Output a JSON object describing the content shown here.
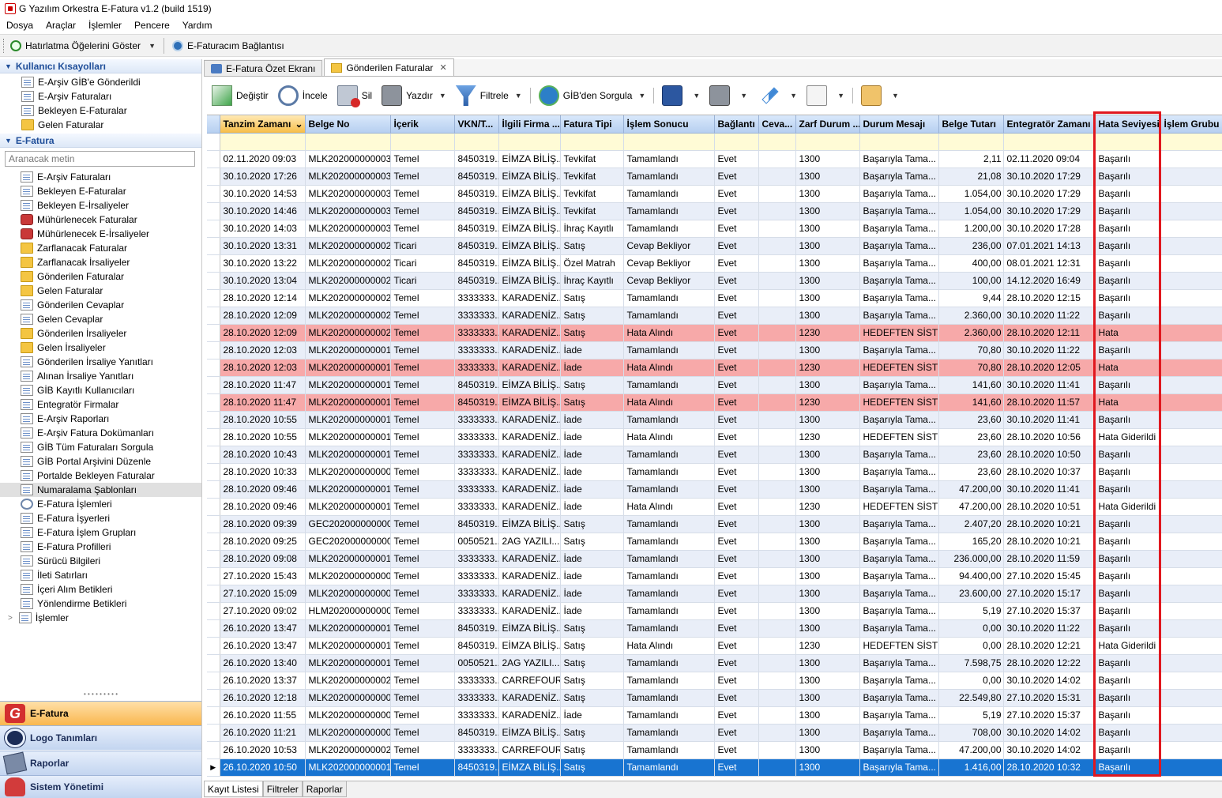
{
  "window": {
    "title": "G Yazılım Orkestra E-Fatura v1.2 (build 1519)"
  },
  "menu": [
    "Dosya",
    "Araçlar",
    "İşlemler",
    "Pencere",
    "Yardım"
  ],
  "toolbar1": {
    "reminders_label": "Hatırlatma Öğelerini Göster",
    "connect_label": "E-Faturacım Bağlantısı"
  },
  "sidebar": {
    "shortcuts_title": "Kullanıcı Kısayolları",
    "shortcuts": [
      "E-Arşiv GİB'e Gönderildi",
      "E-Arşiv Faturaları",
      "Bekleyen E-Faturalar",
      "Gelen Faturalar"
    ],
    "efatura_title": "E-Fatura",
    "search_placeholder": "Aranacak metin",
    "items": [
      "E-Arşiv Faturaları",
      "Bekleyen E-Faturalar",
      "Bekleyen E-İrsaliyeler",
      "Mühürlenecek Faturalar",
      "Mühürlenecek E-İrsaliyeler",
      "Zarflanacak Faturalar",
      "Zarflanacak İrsaliyeler",
      "Gönderilen Faturalar",
      "Gelen Faturalar",
      "Gönderilen Cevaplar",
      "Gelen Cevaplar",
      "Gönderilen İrsaliyeler",
      "Gelen İrsaliyeler",
      "Gönderilen İrsaliye Yanıtları",
      "Alınan İrsaliye Yanıtları",
      "GİB Kayıtlı Kullanıcıları",
      "Entegratör Firmalar",
      "E-Arşiv Raporları",
      "E-Arşiv Fatura Dokümanları",
      "GİB Tüm Faturaları Sorgula",
      "GİB Portal Arşivini Düzenle",
      "Portalde Bekleyen Faturalar",
      "Numaralama Şablonları",
      "E-Fatura İşlemleri",
      "E-Fatura İşyerleri",
      "E-Fatura İşlem Grupları",
      "E-Fatura Profilleri",
      "Sürücü Bilgileri",
      "İleti Satırları",
      "İçeri Alım Betikleri",
      "Yönlendirme Betikleri"
    ],
    "tree_last": "İşlemler",
    "nav": [
      "E-Fatura",
      "Logo Tanımları",
      "Raporlar",
      "Sistem Yönetimi"
    ]
  },
  "tabs": [
    {
      "label": "E-Fatura Özet Ekranı"
    },
    {
      "label": "Gönderilen Faturalar"
    }
  ],
  "toolbar2": {
    "change": "Değiştir",
    "view": "İncele",
    "delete": "Sil",
    "print": "Yazdır",
    "filter": "Filtrele",
    "gib_query": "GİB'den Sorgula"
  },
  "grid": {
    "columns": [
      "Tanzim Zamanı",
      "Belge No",
      "İçerik",
      "VKN/T...",
      "İlgili Firma ...",
      "Fatura Tipi",
      "İşlem Sonucu",
      "Bağlantı",
      "Ceva...",
      "Zarf Durum ...",
      "Durum Mesajı",
      "Belge Tutarı",
      "Entegratör Zamanı",
      "Hata Seviyesi",
      "İşlem Grubu"
    ],
    "rows": [
      [
        "02.11.2020 09:03",
        "MLK2020000000035",
        "Temel",
        "8450319...",
        "EİMZA BİLİŞ...",
        "Tevkifat",
        "Tamamlandı",
        "Evet",
        "",
        "1300",
        "Başarıyla Tama...",
        "2,11",
        "02.11.2020 09:04",
        "Başarılı",
        ""
      ],
      [
        "30.10.2020 17:26",
        "MLK2020000000034",
        "Temel",
        "8450319...",
        "EİMZA BİLİŞ...",
        "Tevkifat",
        "Tamamlandı",
        "Evet",
        "",
        "1300",
        "Başarıyla Tama...",
        "21,08",
        "30.10.2020 17:29",
        "Başarılı",
        ""
      ],
      [
        "30.10.2020 14:53",
        "MLK2020000000032",
        "Temel",
        "8450319...",
        "EİMZA BİLİŞ...",
        "Tevkifat",
        "Tamamlandı",
        "Evet",
        "",
        "1300",
        "Başarıyla Tama...",
        "1.054,00",
        "30.10.2020 17:29",
        "Başarılı",
        ""
      ],
      [
        "30.10.2020 14:46",
        "MLK2020000000031",
        "Temel",
        "8450319...",
        "EİMZA BİLİŞ...",
        "Tevkifat",
        "Tamamlandı",
        "Evet",
        "",
        "1300",
        "Başarıyla Tama...",
        "1.054,00",
        "30.10.2020 17:29",
        "Başarılı",
        ""
      ],
      [
        "30.10.2020 14:03",
        "MLK2020000000030",
        "Temel",
        "8450319...",
        "EİMZA BİLİŞ...",
        "İhraç Kayıtlı",
        "Tamamlandı",
        "Evet",
        "",
        "1300",
        "Başarıyla Tama...",
        "1.200,00",
        "30.10.2020 17:28",
        "Başarılı",
        ""
      ],
      [
        "30.10.2020 13:31",
        "MLK2020000000025",
        "Ticari",
        "8450319...",
        "EİMZA BİLİŞ...",
        "Satış",
        "Cevap Bekliyor",
        "Evet",
        "",
        "1300",
        "Başarıyla Tama...",
        "236,00",
        "07.01.2021 14:13",
        "Başarılı",
        ""
      ],
      [
        "30.10.2020 13:22",
        "MLK2020000000024",
        "Ticari",
        "8450319...",
        "EİMZA BİLİŞ...",
        "Özel Matrah",
        "Cevap Bekliyor",
        "Evet",
        "",
        "1300",
        "Başarıyla Tama...",
        "400,00",
        "08.01.2021 12:31",
        "Başarılı",
        ""
      ],
      [
        "30.10.2020 13:04",
        "MLK2020000000022",
        "Ticari",
        "8450319...",
        "EİMZA BİLİŞ...",
        "İhraç Kayıtlı",
        "Cevap Bekliyor",
        "Evet",
        "",
        "1300",
        "Başarıyla Tama...",
        "100,00",
        "14.12.2020 16:49",
        "Başarılı",
        ""
      ],
      [
        "28.10.2020 12:14",
        "MLK2020000000021",
        "Temel",
        "3333333...",
        "KARADENİZ...",
        "Satış",
        "Tamamlandı",
        "Evet",
        "",
        "1300",
        "Başarıyla Tama...",
        "9,44",
        "28.10.2020 12:15",
        "Başarılı",
        ""
      ],
      [
        "28.10.2020 12:09",
        "MLK2020000000020",
        "Temel",
        "3333333...",
        "KARADENİZ...",
        "Satış",
        "Tamamlandı",
        "Evet",
        "",
        "1300",
        "Başarıyla Tama...",
        "2.360,00",
        "30.10.2020 11:22",
        "Başarılı",
        ""
      ],
      [
        "28.10.2020 12:09",
        "MLK2020000000020",
        "Temel",
        "3333333...",
        "KARADENİZ...",
        "Satış",
        "Hata Alındı",
        "Evet",
        "",
        "1230",
        "HEDEFTEN SİSTE...",
        "2.360,00",
        "28.10.2020 12:11",
        "Hata",
        ""
      ],
      [
        "28.10.2020 12:03",
        "MLK2020000000019",
        "Temel",
        "3333333...",
        "KARADENİZ...",
        "İade",
        "Tamamlandı",
        "Evet",
        "",
        "1300",
        "Başarıyla Tama...",
        "70,80",
        "30.10.2020 11:22",
        "Başarılı",
        ""
      ],
      [
        "28.10.2020 12:03",
        "MLK2020000000019",
        "Temel",
        "3333333...",
        "KARADENİZ...",
        "İade",
        "Hata Alındı",
        "Evet",
        "",
        "1230",
        "HEDEFTEN SİSTE...",
        "70,80",
        "28.10.2020 12:05",
        "Hata",
        ""
      ],
      [
        "28.10.2020 11:47",
        "MLK2020000000018",
        "Temel",
        "8450319...",
        "EİMZA BİLİŞ...",
        "Satış",
        "Tamamlandı",
        "Evet",
        "",
        "1300",
        "Başarıyla Tama...",
        "141,60",
        "30.10.2020 11:41",
        "Başarılı",
        ""
      ],
      [
        "28.10.2020 11:47",
        "MLK2020000000018",
        "Temel",
        "8450319...",
        "EİMZA BİLİŞ...",
        "Satış",
        "Hata Alındı",
        "Evet",
        "",
        "1230",
        "HEDEFTEN SİSTE...",
        "141,60",
        "28.10.2020 11:57",
        "Hata",
        ""
      ],
      [
        "28.10.2020 10:55",
        "MLK2020000000017",
        "Temel",
        "3333333...",
        "KARADENİZ...",
        "İade",
        "Tamamlandı",
        "Evet",
        "",
        "1300",
        "Başarıyla Tama...",
        "23,60",
        "30.10.2020 11:41",
        "Başarılı",
        ""
      ],
      [
        "28.10.2020 10:55",
        "MLK2020000000017",
        "Temel",
        "3333333...",
        "KARADENİZ...",
        "İade",
        "Hata Alındı",
        "Evet",
        "",
        "1230",
        "HEDEFTEN SİSTE...",
        "23,60",
        "28.10.2020 10:56",
        "Hata Giderildi",
        ""
      ],
      [
        "28.10.2020 10:43",
        "MLK2020000000015",
        "Temel",
        "3333333...",
        "KARADENİZ...",
        "İade",
        "Tamamlandı",
        "Evet",
        "",
        "1300",
        "Başarıyla Tama...",
        "23,60",
        "28.10.2020 10:50",
        "Başarılı",
        ""
      ],
      [
        "28.10.2020 10:33",
        "MLK2020000000007",
        "Temel",
        "3333333...",
        "KARADENİZ...",
        "İade",
        "Tamamlandı",
        "Evet",
        "",
        "1300",
        "Başarıyla Tama...",
        "23,60",
        "28.10.2020 10:37",
        "Başarılı",
        ""
      ],
      [
        "28.10.2020 09:46",
        "MLK2020000000016",
        "Temel",
        "3333333...",
        "KARADENİZ...",
        "İade",
        "Tamamlandı",
        "Evet",
        "",
        "1300",
        "Başarıyla Tama...",
        "47.200,00",
        "30.10.2020 11:41",
        "Başarılı",
        ""
      ],
      [
        "28.10.2020 09:46",
        "MLK2020000000016",
        "Temel",
        "3333333...",
        "KARADENİZ...",
        "İade",
        "Hata Alındı",
        "Evet",
        "",
        "1230",
        "HEDEFTEN SİSTE...",
        "47.200,00",
        "28.10.2020 10:51",
        "Hata Giderildi",
        ""
      ],
      [
        "28.10.2020 09:39",
        "GEC2020000000002",
        "Temel",
        "8450319...",
        "EİMZA BİLİŞ...",
        "Satış",
        "Tamamlandı",
        "Evet",
        "",
        "1300",
        "Başarıyla Tama...",
        "2.407,20",
        "28.10.2020 10:21",
        "Başarılı",
        ""
      ],
      [
        "28.10.2020 09:25",
        "GEC2020000000001",
        "Temel",
        "0050521...",
        "2AG YAZILI...",
        "Satış",
        "Tamamlandı",
        "Evet",
        "",
        "1300",
        "Başarıyla Tama...",
        "165,20",
        "28.10.2020 10:21",
        "Başarılı",
        ""
      ],
      [
        "28.10.2020 09:08",
        "MLK2020000000014",
        "Temel",
        "3333333...",
        "KARADENİZ...",
        "İade",
        "Tamamlandı",
        "Evet",
        "",
        "1300",
        "Başarıyla Tama...",
        "236.000,00",
        "28.10.2020 11:59",
        "Başarılı",
        ""
      ],
      [
        "27.10.2020 15:43",
        "MLK2020000000006",
        "Temel",
        "3333333...",
        "KARADENİZ...",
        "İade",
        "Tamamlandı",
        "Evet",
        "",
        "1300",
        "Başarıyla Tama...",
        "94.400,00",
        "27.10.2020 15:45",
        "Başarılı",
        ""
      ],
      [
        "27.10.2020 15:09",
        "MLK2020000000004",
        "Temel",
        "3333333...",
        "KARADENİZ...",
        "İade",
        "Tamamlandı",
        "Evet",
        "",
        "1300",
        "Başarıyla Tama...",
        "23.600,00",
        "27.10.2020 15:17",
        "Başarılı",
        ""
      ],
      [
        "27.10.2020 09:02",
        "HLM202000000000...",
        "Temel",
        "3333333...",
        "KARADENİZ...",
        "İade",
        "Tamamlandı",
        "Evet",
        "",
        "1300",
        "Başarıyla Tama...",
        "5,19",
        "27.10.2020 15:37",
        "Başarılı",
        ""
      ],
      [
        "26.10.2020 13:47",
        "MLK2020000000011",
        "Temel",
        "8450319...",
        "EİMZA BİLİŞ...",
        "Satış",
        "Tamamlandı",
        "Evet",
        "",
        "1300",
        "Başarıyla Tama...",
        "0,00",
        "30.10.2020 11:22",
        "Başarılı",
        ""
      ],
      [
        "26.10.2020 13:47",
        "MLK2020000000011",
        "Temel",
        "8450319...",
        "EİMZA BİLİŞ...",
        "Satış",
        "Hata Alındı",
        "Evet",
        "",
        "1230",
        "HEDEFTEN SİSTE...",
        "0,00",
        "28.10.2020 12:21",
        "Hata Giderildi",
        ""
      ],
      [
        "26.10.2020 13:40",
        "MLK2020000000010",
        "Temel",
        "0050521...",
        "2AG YAZILI...",
        "Satış",
        "Tamamlandı",
        "Evet",
        "",
        "1300",
        "Başarıyla Tama...",
        "7.598,75",
        "28.10.2020 12:22",
        "Başarılı",
        ""
      ],
      [
        "26.10.2020 13:37",
        "MLK2020000000029",
        "Temel",
        "3333333...",
        "CARREFOUR",
        "Satış",
        "Tamamlandı",
        "Evet",
        "",
        "1300",
        "Başarıyla Tama...",
        "0,00",
        "30.10.2020 14:02",
        "Başarılı",
        ""
      ],
      [
        "26.10.2020 12:18",
        "MLK2020000000005",
        "Temel",
        "3333333...",
        "KARADENİZ...",
        "Satış",
        "Tamamlandı",
        "Evet",
        "",
        "1300",
        "Başarıyla Tama...",
        "22.549,80",
        "27.10.2020 15:31",
        "Başarılı",
        ""
      ],
      [
        "26.10.2020 11:55",
        "MLK2020000000003",
        "Temel",
        "3333333...",
        "KARADENİZ...",
        "İade",
        "Tamamlandı",
        "Evet",
        "",
        "1300",
        "Başarıyla Tama...",
        "5,19",
        "27.10.2020 15:37",
        "Başarılı",
        ""
      ],
      [
        "26.10.2020 11:21",
        "MLK2020000000002",
        "Temel",
        "8450319...",
        "EİMZA BİLİŞ...",
        "Satış",
        "Tamamlandı",
        "Evet",
        "",
        "1300",
        "Başarıyla Tama...",
        "708,00",
        "30.10.2020 14:02",
        "Başarılı",
        ""
      ],
      [
        "26.10.2020 10:53",
        "MLK2020000000028",
        "Temel",
        "3333333...",
        "CARREFOUR",
        "Satış",
        "Tamamlandı",
        "Evet",
        "",
        "1300",
        "Başarıyla Tama...",
        "47.200,00",
        "30.10.2020 14:02",
        "Başarılı",
        ""
      ],
      [
        "26.10.2020 10:50",
        "MLK2020000000013",
        "Temel",
        "8450319...",
        "EİMZA BİLİŞ...",
        "Satış",
        "Tamamlandı",
        "Evet",
        "",
        "1300",
        "Başarıyla Tama...",
        "1.416,00",
        "28.10.2020 10:32",
        "Başarılı",
        ""
      ]
    ],
    "error_row_indices": [
      10,
      12,
      14
    ],
    "selected_row_index": 35
  },
  "bottom_tabs": [
    "Kayıt Listesi",
    "Filtreler",
    "Raporlar"
  ],
  "colors": {
    "error_row": "#f7a9a9",
    "selected_row": "#1874d1",
    "highlight_box": "#e0181f",
    "alt_row": "#e9eef8"
  }
}
